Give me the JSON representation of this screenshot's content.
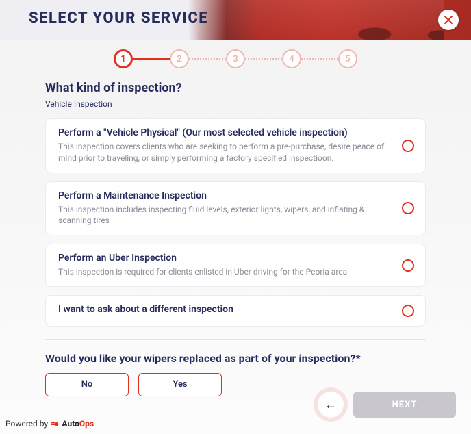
{
  "header": {
    "title": "SELECT YOUR SERVICE"
  },
  "stepper": {
    "steps": [
      "1",
      "2",
      "3",
      "4",
      "5"
    ],
    "active_index": 0
  },
  "question1": {
    "title": "What kind of inspection?",
    "subtitle": "Vehicle Inspection",
    "options": [
      {
        "title": "Perform a \"Vehicle Physical\" (Our most selected vehicle inspection)",
        "desc": "This inspection covers clients who are seeking to perform a pre-purchase, desire peace of mind prior to traveling, or simply performing a factory specified inspectioon."
      },
      {
        "title": "Perform a Maintenance Inspection",
        "desc": "This inspection includes inspecting fluid levels, exterior lights, wipers, and inflating & scanning tires"
      },
      {
        "title": "Perform an Uber Inspection",
        "desc": "This inspection is required for clients enlisted in Uber driving for the Peoria area"
      },
      {
        "title": "I want to ask about a different inspection",
        "desc": ""
      }
    ]
  },
  "question2": {
    "title": "Would you like your wipers replaced as part of your inspection?*",
    "no_label": "No",
    "yes_label": "Yes"
  },
  "nav": {
    "next_label": "NEXT"
  },
  "footer": {
    "powered_by": "Powered by",
    "brand_auto": "Auto",
    "brand_ops": "Ops"
  }
}
